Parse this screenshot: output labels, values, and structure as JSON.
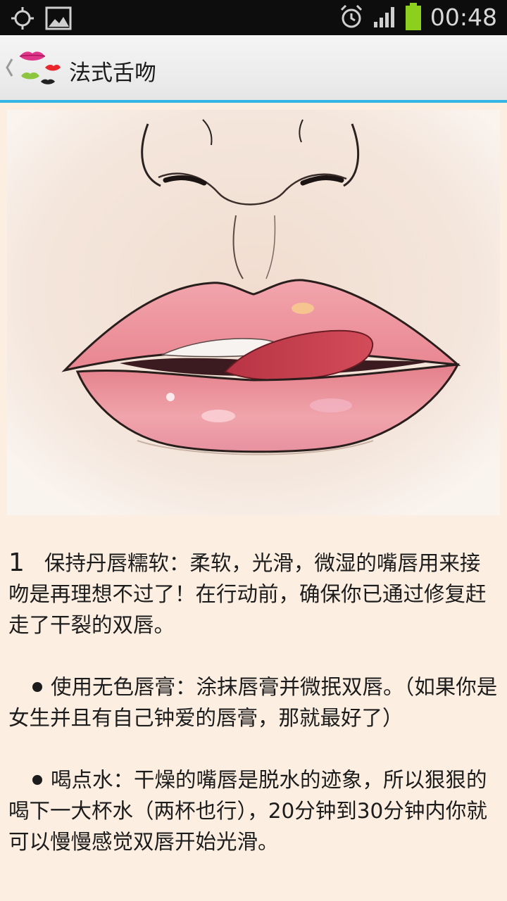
{
  "status_bar": {
    "time": "00:48",
    "icons": [
      "gps-icon",
      "image-icon",
      "alarm-icon",
      "signal-icon",
      "battery-icon"
    ],
    "battery_color": "#8ccf1c"
  },
  "action_bar": {
    "title": "法式舌吻",
    "accent_color": "#33b5e5",
    "icons": [
      "back-chevron-icon",
      "lips-logo-icon"
    ]
  },
  "illustration": {
    "icon": "lips-tongue-illustration"
  },
  "article": {
    "step_number": "1",
    "step_text": "保持丹唇糯软：柔软，光滑，微湿的嘴唇用来接吻是再理想不过了！在行动前，确保你已通过修复赶走了干裂的双唇。",
    "bullet_1": "使用无色唇膏：涂抹唇膏并微抿双唇。（如果你是女生并且有自己钟爱的唇膏，那就最好了）",
    "bullet_2": "喝点水：干燥的嘴唇是脱水的迹象，所以狠狠的喝下一大杯水（两杯也行），20分钟到30分钟内你就可以慢慢感觉双唇开始光滑。"
  }
}
